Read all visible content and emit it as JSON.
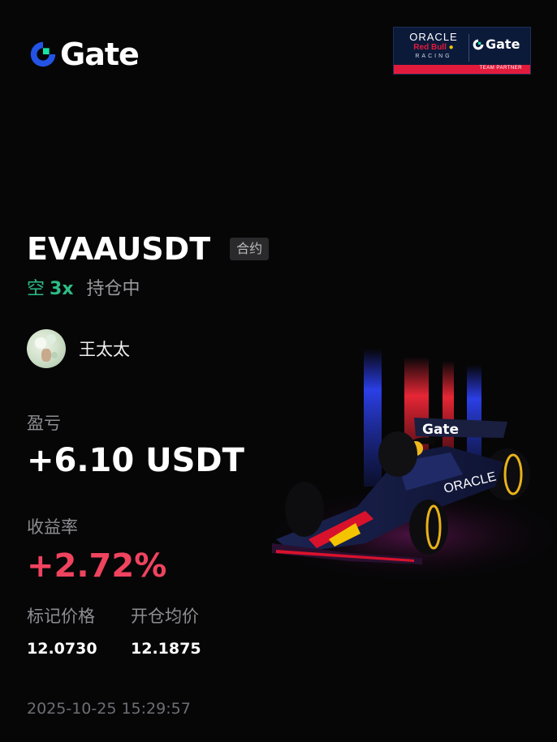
{
  "brand": {
    "name": "Gate",
    "accent": "#2354e6",
    "accent2": "#17e5a7"
  },
  "partner": {
    "line1": "ORACLE",
    "line2": "Red Bull",
    "line3": "RACING",
    "gate": "Gate",
    "footer": "TEAM PARTNER"
  },
  "position": {
    "pair": "EVAAUSDT",
    "type_tag": "合约",
    "side": "空",
    "leverage": "3x",
    "status": "持仓中"
  },
  "user": {
    "name": "王太太"
  },
  "pnl": {
    "label": "盈亏",
    "value": "+6.10 USDT"
  },
  "roi": {
    "label": "收益率",
    "value": "+2.72%"
  },
  "prices": {
    "mark_label": "标记价格",
    "mark_value": "12.0730",
    "entry_label": "开仓均价",
    "entry_value": "12.1875"
  },
  "timestamp": "2025-10-25 15:29:57",
  "colors": {
    "short": "#2dbd85",
    "profit": "#f0435e",
    "background": "#060607"
  }
}
